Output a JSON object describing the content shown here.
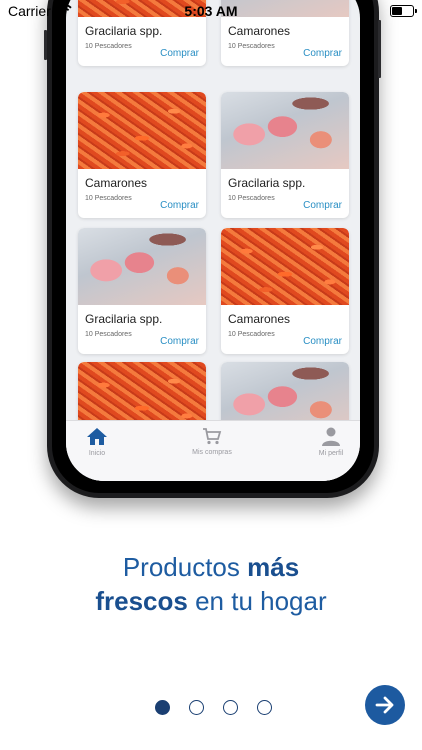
{
  "status_bar": {
    "carrier": "Carrier",
    "time": "5:03 AM",
    "battery_level": 0.5
  },
  "products": [
    {
      "name": "Gracilaria spp.",
      "fishers": "10 Pescadores",
      "action": "Comprar",
      "image": "shrimp"
    },
    {
      "name": "Camarones",
      "fishers": "10 Pescadores",
      "action": "Comprar",
      "image": "fish"
    },
    {
      "name": "Camarones",
      "fishers": "10 Pescadores",
      "action": "Comprar",
      "image": "shrimp"
    },
    {
      "name": "Gracilaria spp.",
      "fishers": "10 Pescadores",
      "action": "Comprar",
      "image": "fish"
    },
    {
      "name": "Gracilaria spp.",
      "fishers": "10 Pescadores",
      "action": "Comprar",
      "image": "fish"
    },
    {
      "name": "Camarones",
      "fishers": "10 Pescadores",
      "action": "Comprar",
      "image": "shrimp"
    },
    {
      "name": "",
      "fishers": "",
      "action": "",
      "image": "shrimp"
    },
    {
      "name": "",
      "fishers": "",
      "action": "",
      "image": "fish"
    }
  ],
  "tabbar": {
    "home": "Inicio",
    "purchases": "Mis compras",
    "profile": "Mi perfil",
    "active_color": "#1e5ca1",
    "inactive_color": "#9a9aa0"
  },
  "headline": {
    "part1": "Productos ",
    "bold1": "más",
    "bold2": "frescos",
    "part2": " en tu hogar"
  },
  "pagination": {
    "total": 4,
    "active_index": 0
  },
  "colors": {
    "brand": "#1e5ca1",
    "link": "#2a8fc4"
  },
  "icons": {
    "next": "arrow-right-icon",
    "home": "home-icon",
    "cart": "cart-icon",
    "profile": "user-icon"
  }
}
